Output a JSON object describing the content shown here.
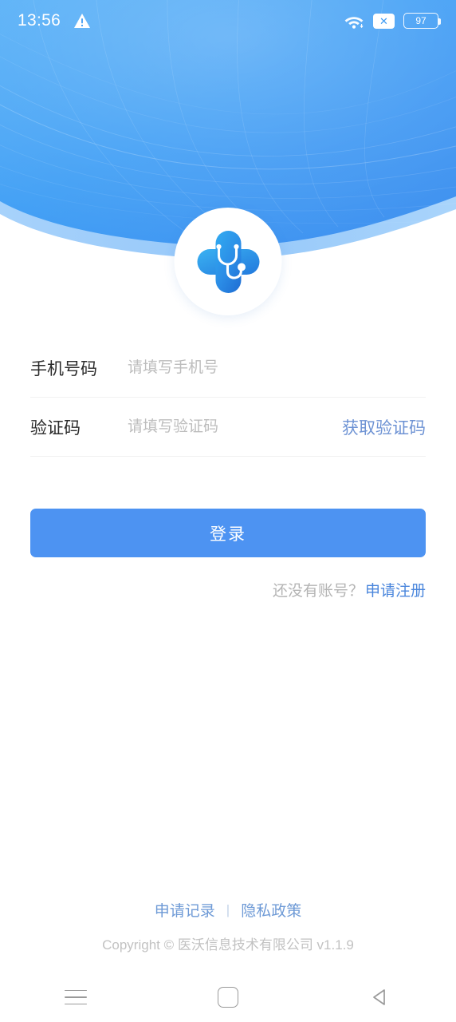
{
  "statusbar": {
    "time": "13:56",
    "warning_icon": "warning-triangle-icon",
    "wifi_icon": "wifi-icon",
    "no_signal_icon": "signal-disabled-icon",
    "battery_level": "97"
  },
  "brand": {
    "logo_icon": "medical-cross-stethoscope-logo",
    "accent_color": "#4d93f2",
    "header_color": "#3f9bf3"
  },
  "form": {
    "phone": {
      "label": "手机号码",
      "placeholder": "请填写手机号",
      "value": ""
    },
    "code": {
      "label": "验证码",
      "placeholder": "请填写验证码",
      "value": "",
      "send_code_label": "获取验证码"
    },
    "login_label": "登录"
  },
  "register": {
    "question": "还没有账号？",
    "link_label": "申请注册"
  },
  "footer": {
    "links": [
      {
        "label": "申请记录"
      },
      {
        "label": "隐私政策"
      }
    ],
    "separator": "|",
    "copyright": "Copyright © 医沃信息技术有限公司   v1.1.9"
  },
  "navbar": {
    "recents_icon": "menu-icon",
    "home_icon": "home-square-icon",
    "back_icon": "back-triangle-icon"
  }
}
